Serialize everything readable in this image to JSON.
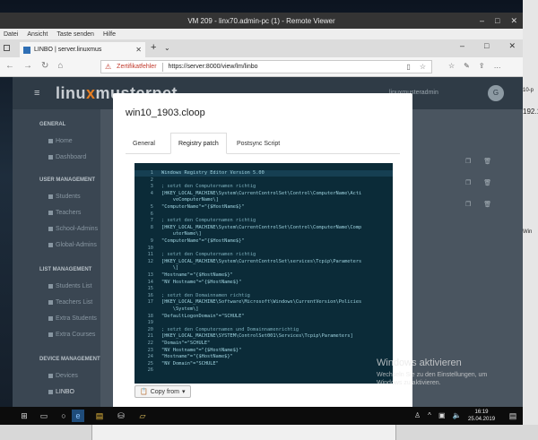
{
  "window": {
    "title": "VM 209 - linx70.admin-pc (1) - Remote Viewer",
    "menu": [
      "Datei",
      "Ansicht",
      "Taste senden",
      "Hilfe"
    ]
  },
  "browser": {
    "tab_title": "LINBO | server.linuxmus",
    "cert_warning": "Zertifikatfehler",
    "url": "https://server:8000/view/lm/linbo"
  },
  "app": {
    "logo_left": "linu",
    "logo_x": "x",
    "logo_right": "musterpet",
    "logo_suffix": "LINBO",
    "user": "linuxmusteradmin",
    "avatar": "G",
    "sidebar": {
      "general": "GENERAL",
      "home": "Home",
      "dashboard": "Dashboard",
      "user_mgmt": "USER MANAGEMENT",
      "students": "Students",
      "teachers": "Teachers",
      "school_admins": "School-Admins",
      "global_admins": "Global-Admins",
      "list_mgmt": "LIST MANAGEMENT",
      "students_list": "Students List",
      "teachers_list": "Teachers List",
      "extra_students": "Extra Students",
      "extra_courses": "Extra Courses",
      "device_mgmt": "DEVICE MANAGEMENT",
      "devices": "Devices",
      "linbo": "LINBO"
    }
  },
  "modal": {
    "title": "win10_1903.cloop",
    "tabs": [
      "General",
      "Registry patch",
      "Postsync Script"
    ],
    "active_tab": "Registry patch",
    "copy_button": "Copy from",
    "lines": [
      {
        "n": "1",
        "t": "Windows Registry Editor Version 5.00"
      },
      {
        "n": "2",
        "t": ""
      },
      {
        "n": "3",
        "t": "; setzt den Computernamen richtig"
      },
      {
        "n": "4",
        "t": "[HKEY_LOCAL_MACHINE\\System\\CurrentControlSet\\Control\\ComputerName\\Acti"
      },
      {
        "n": "",
        "t": "    veComputerName\\]"
      },
      {
        "n": "5",
        "t": "\"ComputerName\"=\"{$HostName$}\""
      },
      {
        "n": "6",
        "t": ""
      },
      {
        "n": "7",
        "t": "; setzt den Computernamen richtig"
      },
      {
        "n": "8",
        "t": "[HKEY_LOCAL_MACHINE\\System\\CurrentControlSet\\Control\\ComputerName\\Comp"
      },
      {
        "n": "",
        "t": "    uterName\\]"
      },
      {
        "n": "9",
        "t": "\"ComputerName\"=\"{$HostName$}\""
      },
      {
        "n": "10",
        "t": ""
      },
      {
        "n": "11",
        "t": "; setzt den Computernamen richtig"
      },
      {
        "n": "12",
        "t": "[HKEY_LOCAL_MACHINE\\System\\CurrentControlSet\\services\\Tcpip\\Parameters"
      },
      {
        "n": "",
        "t": "    \\]"
      },
      {
        "n": "13",
        "t": "\"Hostname\"=\"{$HostName$}\""
      },
      {
        "n": "14",
        "t": "\"NV Hostname\"=\"{$HostName$}\""
      },
      {
        "n": "15",
        "t": ""
      },
      {
        "n": "16",
        "t": "; setzt den Domainnamen richtig"
      },
      {
        "n": "17",
        "t": "[HKEY_LOCAL_MACHINE\\Software\\Microsoft\\Windows\\CurrentVersion\\Policies"
      },
      {
        "n": "",
        "t": "    \\System\\]"
      },
      {
        "n": "18",
        "t": "\"DefaultLogonDomain\"=\"SCHULE\""
      },
      {
        "n": "19",
        "t": ""
      },
      {
        "n": "20",
        "t": "; setzt den Computernamen und Domainnamenrichtig"
      },
      {
        "n": "21",
        "t": "[HKEY_LOCAL_MACHINE\\SYSTEM\\ControlSet001\\Services\\Tcpip\\Parameters]"
      },
      {
        "n": "22",
        "t": "\"Domain\"=\"SCHULE\""
      },
      {
        "n": "23",
        "t": "\"NV Hostname\"=\"{$HostName$}\""
      },
      {
        "n": "24",
        "t": "\"Hostname\"=\"{$HostName$}\""
      },
      {
        "n": "25",
        "t": "\"NV Domain\"=\"SCHULE\""
      },
      {
        "n": "26",
        "t": ""
      }
    ]
  },
  "watermark": {
    "title": "Windows aktivieren",
    "text": "Wechseln Sie zu den Einstellungen, um Windows zu aktivieren."
  },
  "taskbar": {
    "time": "16:19",
    "date": "25.04.2019"
  },
  "outer_right": [
    "10-p",
    "192.1",
    "Win"
  ]
}
